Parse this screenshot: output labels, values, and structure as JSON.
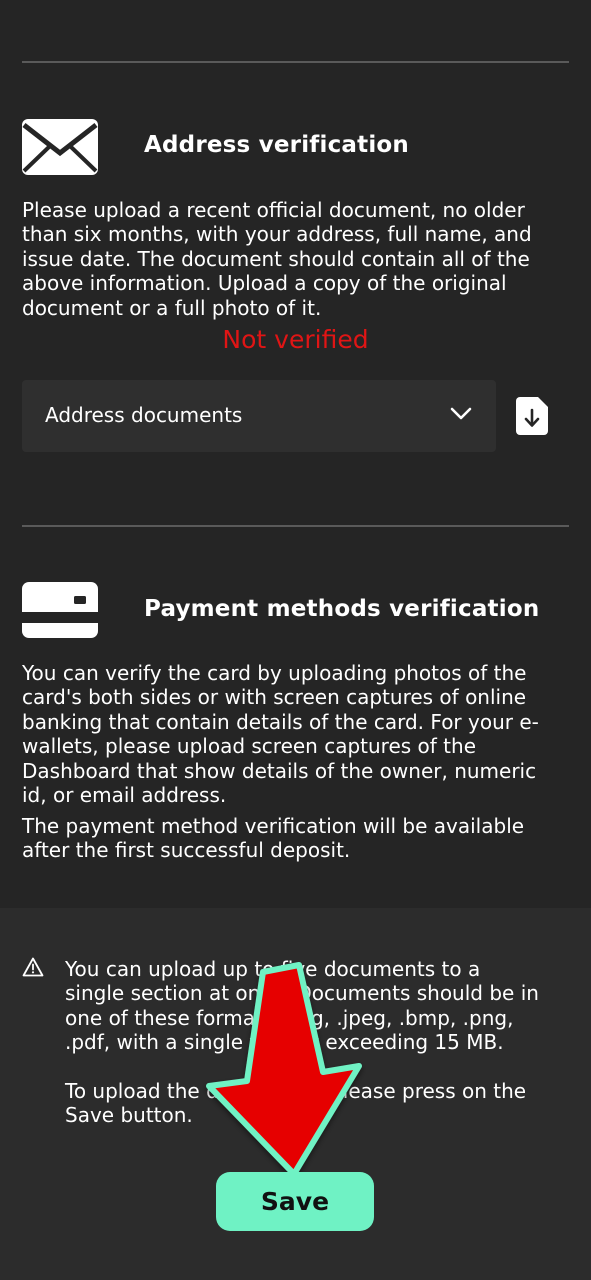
{
  "address_section": {
    "title": "Address verification",
    "icon": "envelope-icon",
    "description_lines": [
      "Please upload a recent official document, no older",
      "than six months, with your address, full name, and",
      "issue date. The document should contain all of the",
      "above information. Upload a copy of the original",
      "document or a full photo of it."
    ],
    "status": "Not verified",
    "status_color": "#e01515",
    "select": {
      "value": "Address documents",
      "icon": "chevron-down-icon"
    },
    "upload_icon": "upload-file-icon"
  },
  "payment_section": {
    "title": "Payment methods verification",
    "icon": "card-icon",
    "description_lines": [
      "You can verify the card by uploading photos of the",
      "card's both sides or with screen captures of online",
      "banking that contain details of the card. For your e-",
      "wallets, please upload screen captures of the",
      "Dashboard that show details of the owner, numeric",
      "id, or email address."
    ],
    "note_lines": [
      "The payment method verification will be available",
      "after the first successful deposit."
    ]
  },
  "notice": {
    "icon": "warning-icon",
    "paragraph1_lines": [
      "You can upload up to five documents to a",
      "single section at once. Documents should be in",
      "one of these formats: .jpg, .jpeg, .bmp, .png,",
      ".pdf, with a single file not exceeding 15 MB."
    ],
    "paragraph2_lines": [
      "To upload the documents, please press on the",
      "Save button."
    ]
  },
  "save_button": {
    "label": "Save",
    "color": "#6ff2c4"
  },
  "overlay": {
    "icon": "red-arrow-down-icon",
    "color": "#e60000"
  }
}
